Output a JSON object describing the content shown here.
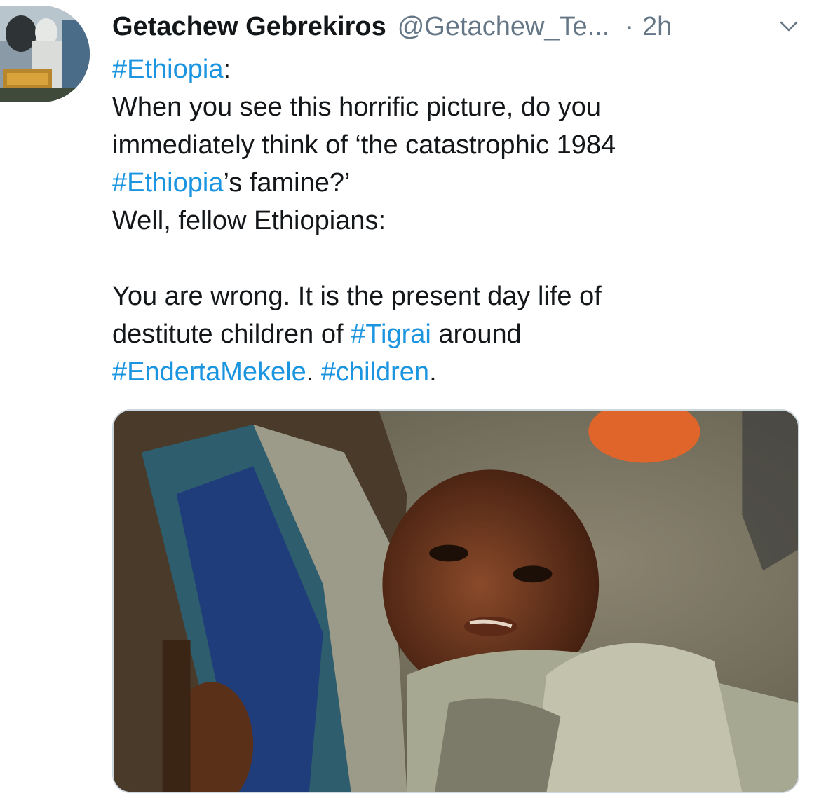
{
  "tweet": {
    "author": {
      "display_name": "Getachew Gebrekiros",
      "handle": "@Getachew_Te...",
      "separator": "·",
      "time": "2h"
    },
    "text": {
      "line1_tag": "#Ethiopia",
      "line1_rest": ":",
      "line2": "When you see this horrific picture, do  you",
      "line3": "immediately think of ‘the catastrophic  1984",
      "line4_tag": "#Ethiopia",
      "line4_rest": "’s famine?’",
      "line5": "Well, fellow Ethiopians:",
      "line6": "You are wrong. It is the present day life of",
      "line7_pre": "destitute children of ",
      "line7_tag": "#Tigrai",
      "line7_post": " around",
      "line8_tag1": "#EndertaMekele",
      "line8_sep": ". ",
      "line8_tag2": "#children",
      "line8_end": "."
    },
    "icons": {
      "avatar": "profile-photo",
      "menu": "chevron-down-icon"
    },
    "colors": {
      "link": "#1b95e0",
      "secondary_text": "#657786",
      "primary_text": "#14171a",
      "media_border": "#ccd6dd"
    }
  }
}
